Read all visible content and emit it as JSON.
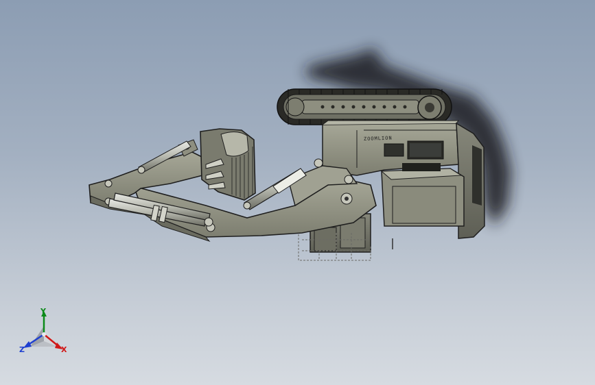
{
  "viewport": {
    "background_top": "#8c9db3",
    "background_bottom": "#d6dbe1"
  },
  "model": {
    "label_text": "ZOOMLION",
    "body_color": "#8e8f80",
    "edge_color": "#1e1e1e",
    "shadow_color": "#1a1c22"
  },
  "triad": {
    "x_label": "X",
    "y_label": "Y",
    "z_label": "Z",
    "x_color": "#d01818",
    "y_color": "#0b8a19",
    "z_color": "#1e3fd0"
  }
}
